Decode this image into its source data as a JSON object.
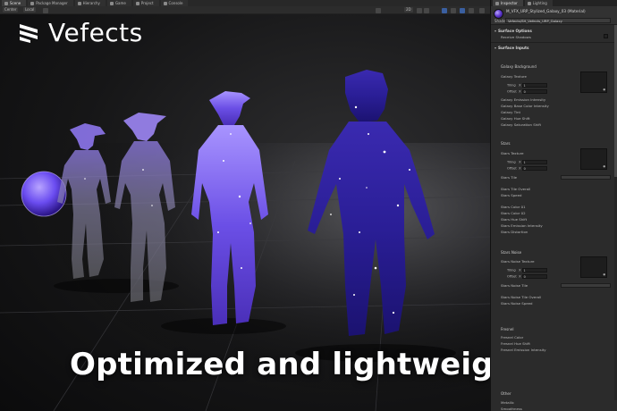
{
  "scene_tabs": [
    {
      "label": "Scene",
      "active": true
    },
    {
      "label": "Package Manager",
      "active": false
    },
    {
      "label": "Hierarchy",
      "active": false
    },
    {
      "label": "Game",
      "active": false
    },
    {
      "label": "Project",
      "active": false
    },
    {
      "label": "Console",
      "active": false
    }
  ],
  "toolbar": {
    "center_label": "Center",
    "local_label": "Local",
    "mode_2d_label": "2D"
  },
  "logo": {
    "text": "Vefects"
  },
  "headline": "Optimized and lightweight!",
  "inspector": {
    "tabs": [
      {
        "label": "Inspector",
        "active": true
      },
      {
        "label": "Lighting",
        "active": false
      }
    ],
    "material_name": "M_VFX_URP_Stylized_Galaxy_03 (Material)",
    "shader_label": "Shader",
    "shader_value": "Vefects/SH_Vefects_URP_Galaxy",
    "sections": {
      "surface_options": "Surface Options",
      "receive_shadows": "Receive Shadows",
      "surface_inputs": "Surface Inputs",
      "galaxy_background": "Galaxy Background",
      "galaxy_texture": "Galaxy Texture",
      "tiling": "Tiling",
      "offset": "Offset",
      "x": "X",
      "tiling_x": "1",
      "offset_x": "0",
      "galaxy_props": [
        "Galaxy Emission Intensity",
        "Galaxy Base Color Intensity",
        "Galaxy Tint",
        "Galaxy Hue Shift",
        "Galaxy Saturation Shift"
      ],
      "stars": "Stars",
      "stars_texture": "Stars Texture",
      "stars_tile": "Stars Tile",
      "stars_props_a": [
        "Stars Tile Overall",
        "Stars Speed"
      ],
      "stars_props_b": [
        "Stars Color 01",
        "Stars Color 02",
        "Stars Hue Shift",
        "Stars Emission Intensity",
        "Stars Distortion"
      ],
      "stars_noise": "Stars Noise",
      "stars_noise_texture": "Stars Noise Texture",
      "stars_noise_tile": "Stars Noise Tile",
      "stars_noise_props": [
        "Stars Noise Tile Overall",
        "Stars Noise Speed"
      ],
      "fresnel": "Fresnel",
      "fresnel_props": [
        "Fresnel Color",
        "Fresnel Hue Shift",
        "Fresnel Emission Intensity"
      ],
      "other": "Other",
      "other_props": [
        "Metallic",
        "Smoothness"
      ]
    }
  },
  "colors": {
    "galaxy_purple": "#6a4cff",
    "galaxy_deep": "#2a1a9a",
    "panel_bg": "#2b2b2b"
  },
  "icons": [
    "vefects-logo-icon",
    "material-sphere-icon",
    "gizmo-icon",
    "lock-icon"
  ]
}
